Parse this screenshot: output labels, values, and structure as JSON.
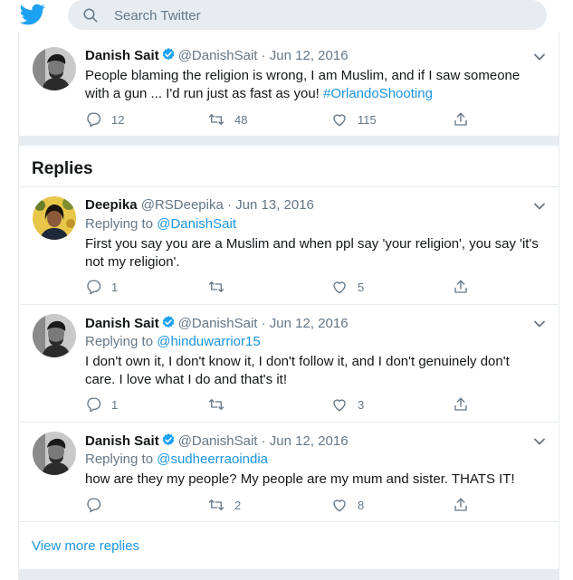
{
  "search": {
    "placeholder": "Search Twitter"
  },
  "colors": {
    "accent": "#1da1f2",
    "link": "#1b95e0",
    "muted": "#657786",
    "divider": "#e6ecf0"
  },
  "main_tweet": {
    "name": "Danish Sait",
    "handle": "@DanishSait",
    "date": "· Jun 12, 2016",
    "text_before": "People blaming the religion is wrong, I am Muslim, and if I saw someone with a gun ... I'd run just as fast as you! ",
    "hashtag": "#OrlandoShooting",
    "reply_count": "12",
    "retweet_count": "48",
    "like_count": "115"
  },
  "replies_heading": "Replies",
  "replies": [
    {
      "name": "Deepika",
      "handle": "@RSDeepika",
      "date": "· Jun 13, 2016",
      "replying_prefix": "Replying to ",
      "replying_to": "@DanishSait",
      "text": "First you say you are a Muslim and when ppl say 'your religion', you say 'it's not my religion'.",
      "reply_count": "1",
      "retweet_count": "",
      "like_count": "5"
    },
    {
      "name": "Danish Sait",
      "handle": "@DanishSait",
      "date": "· Jun 12, 2016",
      "replying_prefix": "Replying to ",
      "replying_to": "@hinduwarrior15",
      "text": "I don't own it, I don't know it, I don't follow it, and I don't genuinely don't care. I love what I do and that's it!",
      "reply_count": "1",
      "retweet_count": "",
      "like_count": "3"
    },
    {
      "name": "Danish Sait",
      "handle": "@DanishSait",
      "date": "· Jun 12, 2016",
      "replying_prefix": "Replying to ",
      "replying_to": "@sudheerraoindia",
      "text": "how are they my people? My people are my mum and sister. THATS IT!",
      "reply_count": "",
      "retweet_count": "2",
      "like_count": "8"
    }
  ],
  "view_more": "View more replies",
  "icons": [
    "twitter-bird-icon",
    "search-icon",
    "verified-badge-icon",
    "chevron-down-icon",
    "reply-icon",
    "retweet-icon",
    "like-icon",
    "share-icon"
  ]
}
